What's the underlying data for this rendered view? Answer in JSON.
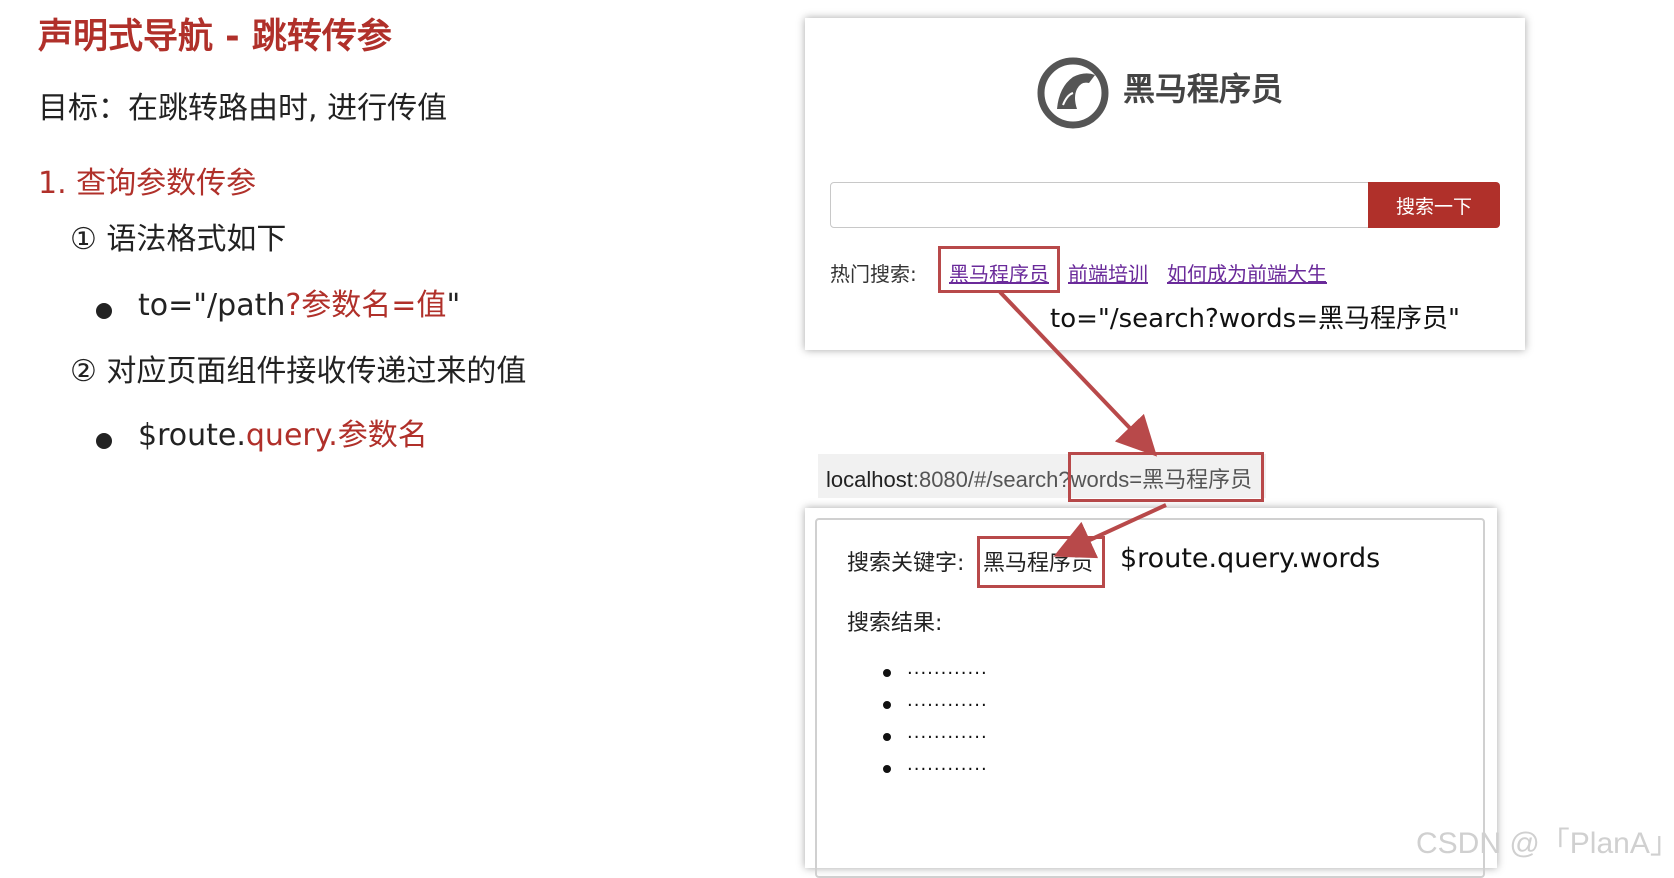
{
  "slide": {
    "title": "声明式导航 - 跳转传参",
    "goal": "目标：在跳转路由时, 进行传值",
    "item1": "1.  查询参数传参",
    "step1": "① 语法格式如下",
    "syntax_prefix": "to=\"/path",
    "syntax_red": "?参数名=值",
    "syntax_suffix": "\"",
    "step2": "② 对应页面组件接收传递过来的值",
    "receive_prefix": "$route.",
    "receive_red": "query.参数名"
  },
  "search_card": {
    "logo_text": "黑马程序员",
    "search_placeholder": "",
    "search_button": "搜索一下",
    "hot_label": "热门搜索:",
    "hot_links": [
      "黑马程序员",
      "前端培训",
      "如何成为前端大生"
    ],
    "to_annotation": "to=\"/search?words=黑马程序员\""
  },
  "url_bar": {
    "host": "localhost",
    "rest": ":8080/#/search",
    "query": "?words=黑马程序员"
  },
  "result_card": {
    "keyword_label": "搜索关键字:",
    "keyword_value": "黑马程序员",
    "query_annotation": "$route.query.words",
    "result_label": "搜索结果:",
    "results": [
      "............",
      "............",
      "............",
      "............"
    ]
  },
  "watermark": "CSDN @「PlanA」",
  "colors": {
    "accent": "#b0302a",
    "box": "#b8494a",
    "link": "#6a2a9a"
  }
}
